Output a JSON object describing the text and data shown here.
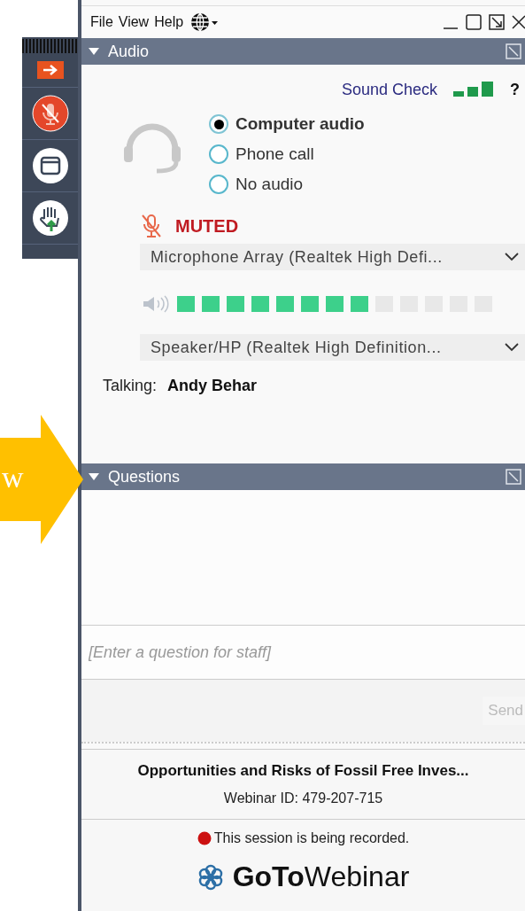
{
  "menu": [
    {
      "label": "File"
    },
    {
      "label": "View"
    },
    {
      "label": "Help"
    }
  ],
  "audio": {
    "title": "Audio",
    "expanded": true,
    "sound_check": "Sound Check",
    "help": "?",
    "options": [
      {
        "label": "Computer audio",
        "selected": true
      },
      {
        "label": "Phone call",
        "selected": false
      },
      {
        "label": "No audio",
        "selected": false
      }
    ],
    "muted_label": "MUTED",
    "microphone": "Microphone Array (Realtek High Defi...",
    "speaker": {
      "level": 0.62,
      "device": "Speaker/HP (Realtek High Definition..."
    },
    "talking": {
      "label": "Talking:",
      "name": "Andy Behar"
    }
  },
  "questions": {
    "title": "Questions",
    "expanded": true,
    "placeholder": "[Enter a question for staff]",
    "send": "Send"
  },
  "footer": {
    "title": "Opportunities and Risks of Fossil Free Inves...",
    "webinar_id": "Webinar ID: 479-207-715",
    "recording": "This session is being recorded.",
    "logo_bold": "GoTo",
    "logo_light": "Webinar"
  },
  "callout": {
    "text": "w"
  }
}
